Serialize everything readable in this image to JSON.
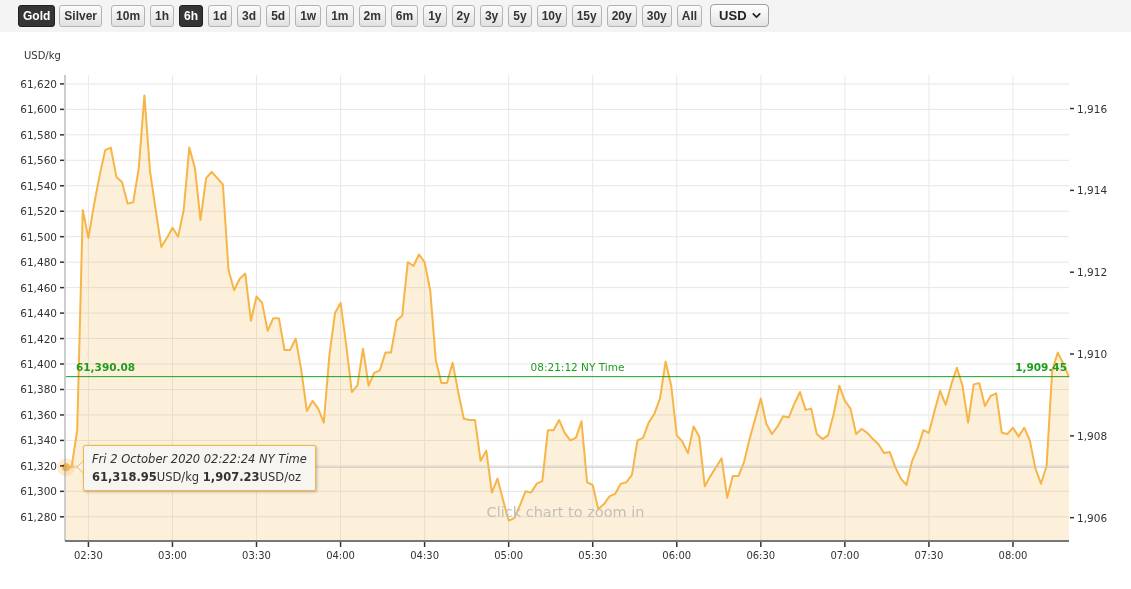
{
  "metal_tabs": [
    {
      "label": "Gold",
      "selected": true
    },
    {
      "label": "Silver",
      "selected": false
    }
  ],
  "range_tabs": [
    {
      "label": "10m",
      "selected": false
    },
    {
      "label": "1h",
      "selected": false
    },
    {
      "label": "6h",
      "selected": true
    },
    {
      "label": "1d",
      "selected": false
    },
    {
      "label": "3d",
      "selected": false
    },
    {
      "label": "5d",
      "selected": false
    },
    {
      "label": "1w",
      "selected": false
    },
    {
      "label": "1m",
      "selected": false
    },
    {
      "label": "2m",
      "selected": false
    },
    {
      "label": "6m",
      "selected": false
    },
    {
      "label": "1y",
      "selected": false
    },
    {
      "label": "2y",
      "selected": false
    },
    {
      "label": "3y",
      "selected": false
    },
    {
      "label": "5y",
      "selected": false
    },
    {
      "label": "10y",
      "selected": false
    },
    {
      "label": "15y",
      "selected": false
    },
    {
      "label": "20y",
      "selected": false
    },
    {
      "label": "30y",
      "selected": false
    },
    {
      "label": "All",
      "selected": false
    }
  ],
  "currency_select": {
    "value": "USD"
  },
  "chart": {
    "hint": "Click chart to zoom in",
    "tooltip": {
      "title": "Fri 2 October 2020 02:22:24 NY Time",
      "text": "**61,318.95**USD/kg **1,907.23**USD/oz"
    },
    "chart_data": {
      "type": "area",
      "ylabel": "USD/kg",
      "grid": true,
      "x": [
        142,
        144,
        146,
        148,
        150,
        152,
        154,
        156,
        158,
        160,
        162,
        164,
        166,
        168,
        170,
        172,
        174,
        176,
        178,
        180,
        182,
        184,
        186,
        188,
        190,
        192,
        194,
        196,
        198,
        200,
        202,
        204,
        206,
        208,
        210,
        212,
        214,
        216,
        218,
        220,
        222,
        224,
        226,
        228,
        230,
        232,
        234,
        236,
        238,
        240,
        242,
        244,
        246,
        248,
        250,
        252,
        254,
        256,
        258,
        260,
        262,
        264,
        266,
        268,
        270,
        272,
        274,
        276,
        278,
        280,
        282,
        284,
        286,
        288,
        290,
        292,
        294,
        296,
        298,
        300,
        302,
        304,
        306,
        308,
        310,
        312,
        314,
        316,
        318,
        320,
        322,
        324,
        326,
        328,
        330,
        332,
        334,
        336,
        338,
        340,
        342,
        344,
        346,
        348,
        350,
        352,
        354,
        356,
        358,
        360,
        362,
        364,
        366,
        368,
        370,
        372,
        374,
        376,
        378,
        380,
        382,
        384,
        386,
        388,
        390,
        392,
        394,
        396,
        398,
        400,
        402,
        404,
        406,
        408,
        410,
        412,
        414,
        416,
        418,
        420,
        422,
        424,
        426,
        428,
        430,
        432,
        434,
        436,
        438,
        440,
        442,
        444,
        446,
        448,
        450,
        452,
        454,
        456,
        458,
        460,
        462,
        464,
        466,
        468,
        470,
        472,
        474,
        476,
        478,
        480,
        482,
        484,
        486,
        488,
        490,
        492,
        494,
        496,
        498,
        500
      ],
      "series": [
        {
          "color": "#f7b548",
          "values": [
            61319,
            61319,
            61348,
            61521,
            61499,
            61525,
            61548,
            61568,
            61570,
            61547,
            61543,
            61526,
            61527,
            61554,
            61611,
            61551,
            61521,
            61492,
            61499,
            61507,
            61500,
            61521,
            61570,
            61554,
            61513,
            61546,
            61551,
            61546,
            61541,
            61474,
            61458,
            61467,
            61471,
            61434,
            61453,
            61448,
            61426,
            61436,
            61436,
            61411,
            61411,
            61420,
            61395,
            61363,
            61371,
            61365,
            61354,
            61407,
            61440,
            61448,
            61415,
            61378,
            61383,
            61412,
            61383,
            61393,
            61395,
            61409,
            61409,
            61434,
            61438,
            61480,
            61477,
            61486,
            61480,
            61458,
            61403,
            61385,
            61385,
            61401,
            61378,
            61357,
            61356,
            61356,
            61324,
            61332,
            61299,
            61310,
            61293,
            61277,
            61279,
            61289,
            61300,
            61299,
            61306,
            61308,
            61348,
            61348,
            61356,
            61346,
            61340,
            61342,
            61355,
            61307,
            61305,
            61286,
            61290,
            61296,
            61298,
            61306,
            61307,
            61313,
            61340,
            61342,
            61354,
            61361,
            61373,
            61402,
            61383,
            61344,
            61339,
            61330,
            61351,
            61343,
            61304,
            61312,
            61319,
            61326,
            61295,
            61312,
            61312,
            61323,
            61341,
            61357,
            61373,
            61353,
            61345,
            61351,
            61359,
            61358,
            61369,
            61378,
            61364,
            61365,
            61345,
            61341,
            61344,
            61361,
            61383,
            61371,
            61365,
            61345,
            61349,
            61346,
            61341,
            61337,
            61330,
            61331,
            61319,
            61310,
            61305,
            61324,
            61334,
            61348,
            61346,
            61363,
            61379,
            61368,
            61384,
            61397,
            61383,
            61354,
            61384,
            61385,
            61367,
            61375,
            61377,
            61346,
            61345,
            61350,
            61343,
            61350,
            61340,
            61318,
            61306,
            61320,
            61395,
            61409,
            61400,
            61390
          ]
        }
      ],
      "xlim": [
        142,
        500
      ],
      "ylim": [
        61261,
        61627
      ],
      "xticks": [
        {
          "value": 150,
          "label": "02:30"
        },
        {
          "value": 180,
          "label": "03:00"
        },
        {
          "value": 210,
          "label": "03:30"
        },
        {
          "value": 240,
          "label": "04:00"
        },
        {
          "value": 270,
          "label": "04:30"
        },
        {
          "value": 300,
          "label": "05:00"
        },
        {
          "value": 330,
          "label": "05:30"
        },
        {
          "value": 360,
          "label": "06:00"
        },
        {
          "value": 390,
          "label": "06:30"
        },
        {
          "value": 420,
          "label": "07:00"
        },
        {
          "value": 450,
          "label": "07:30"
        },
        {
          "value": 480,
          "label": "08:00"
        }
      ],
      "yticks": [
        {
          "value": 61280,
          "label": "61,280"
        },
        {
          "value": 61300,
          "label": "61,300"
        },
        {
          "value": 61320,
          "label": "61,320"
        },
        {
          "value": 61340,
          "label": "61,340"
        },
        {
          "value": 61360,
          "label": "61,360"
        },
        {
          "value": 61380,
          "label": "61,380"
        },
        {
          "value": 61400,
          "label": "61,400"
        },
        {
          "value": 61420,
          "label": "61,420"
        },
        {
          "value": 61440,
          "label": "61,440"
        },
        {
          "value": 61460,
          "label": "61,460"
        },
        {
          "value": 61480,
          "label": "61,480"
        },
        {
          "value": 61500,
          "label": "61,500"
        },
        {
          "value": 61520,
          "label": "61,520"
        },
        {
          "value": 61540,
          "label": "61,540"
        },
        {
          "value": 61560,
          "label": "61,560"
        },
        {
          "value": 61580,
          "label": "61,580"
        },
        {
          "value": 61600,
          "label": "61,600"
        },
        {
          "value": 61620,
          "label": "61,620"
        }
      ],
      "y2lim": [
        1905.43,
        1916.82
      ],
      "y2ticks": [
        {
          "value": 1906,
          "label": "1,906"
        },
        {
          "value": 1908,
          "label": "1,908"
        },
        {
          "value": 1910,
          "label": "1,910"
        },
        {
          "value": 1912,
          "label": "1,912"
        },
        {
          "value": 1914,
          "label": "1,914"
        },
        {
          "value": 1916,
          "label": "1,916"
        }
      ],
      "ref_lines": [
        {
          "axis": "y",
          "value": 61390.08,
          "color": "#1e9e1e",
          "label": "61,390.08"
        },
        {
          "axis": "y",
          "value": 61319,
          "color": "#c4c4c4"
        }
      ],
      "annotations": [
        "08:21:12 NY Time",
        {
          "x": 500,
          "y": 61390,
          "text": "1,909.45"
        }
      ]
    }
  }
}
